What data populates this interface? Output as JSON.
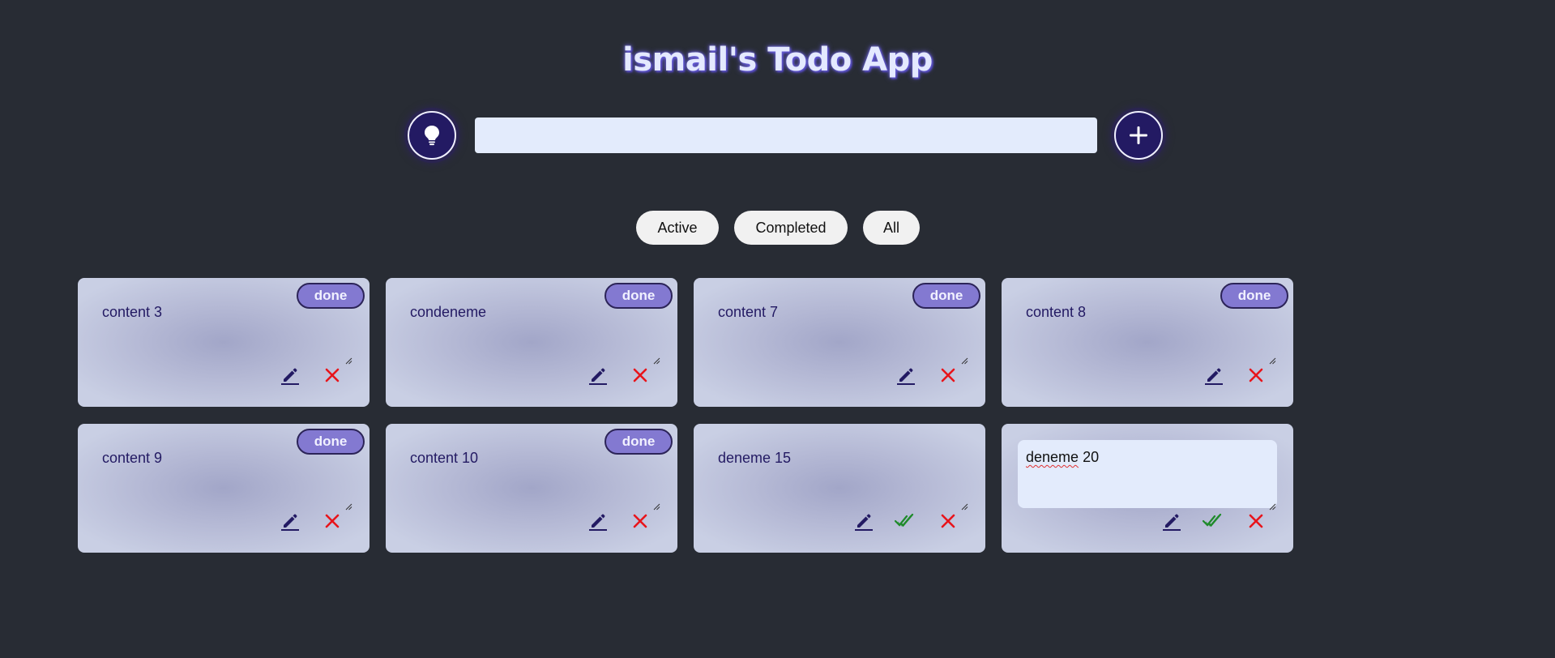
{
  "header": {
    "title": "ismail's Todo App"
  },
  "input": {
    "value": "",
    "placeholder": ""
  },
  "filters": {
    "active": "Active",
    "completed": "Completed",
    "all": "All"
  },
  "badge_label": "done",
  "todos": [
    {
      "text": "content 3",
      "done": true
    },
    {
      "text": "condeneme",
      "done": true
    },
    {
      "text": "content 7",
      "done": true
    },
    {
      "text": "content 8",
      "done": true
    },
    {
      "text": "content 9",
      "done": true
    },
    {
      "text": "content 10",
      "done": true
    },
    {
      "text": "deneme 15",
      "done": false
    },
    {
      "text": "deneme 20",
      "done": false,
      "editing": true,
      "misspelled_word": "deneme",
      "rest": " 20"
    }
  ],
  "colors": {
    "background": "#282c34",
    "accent": "#231a63",
    "badge": "#8379d1",
    "delete": "#e8141b",
    "complete": "#1e8a2a"
  },
  "icons": {
    "idea": "lightbulb-icon",
    "add": "plus-icon",
    "edit": "pencil-icon",
    "complete": "double-check-icon",
    "delete": "close-icon"
  }
}
